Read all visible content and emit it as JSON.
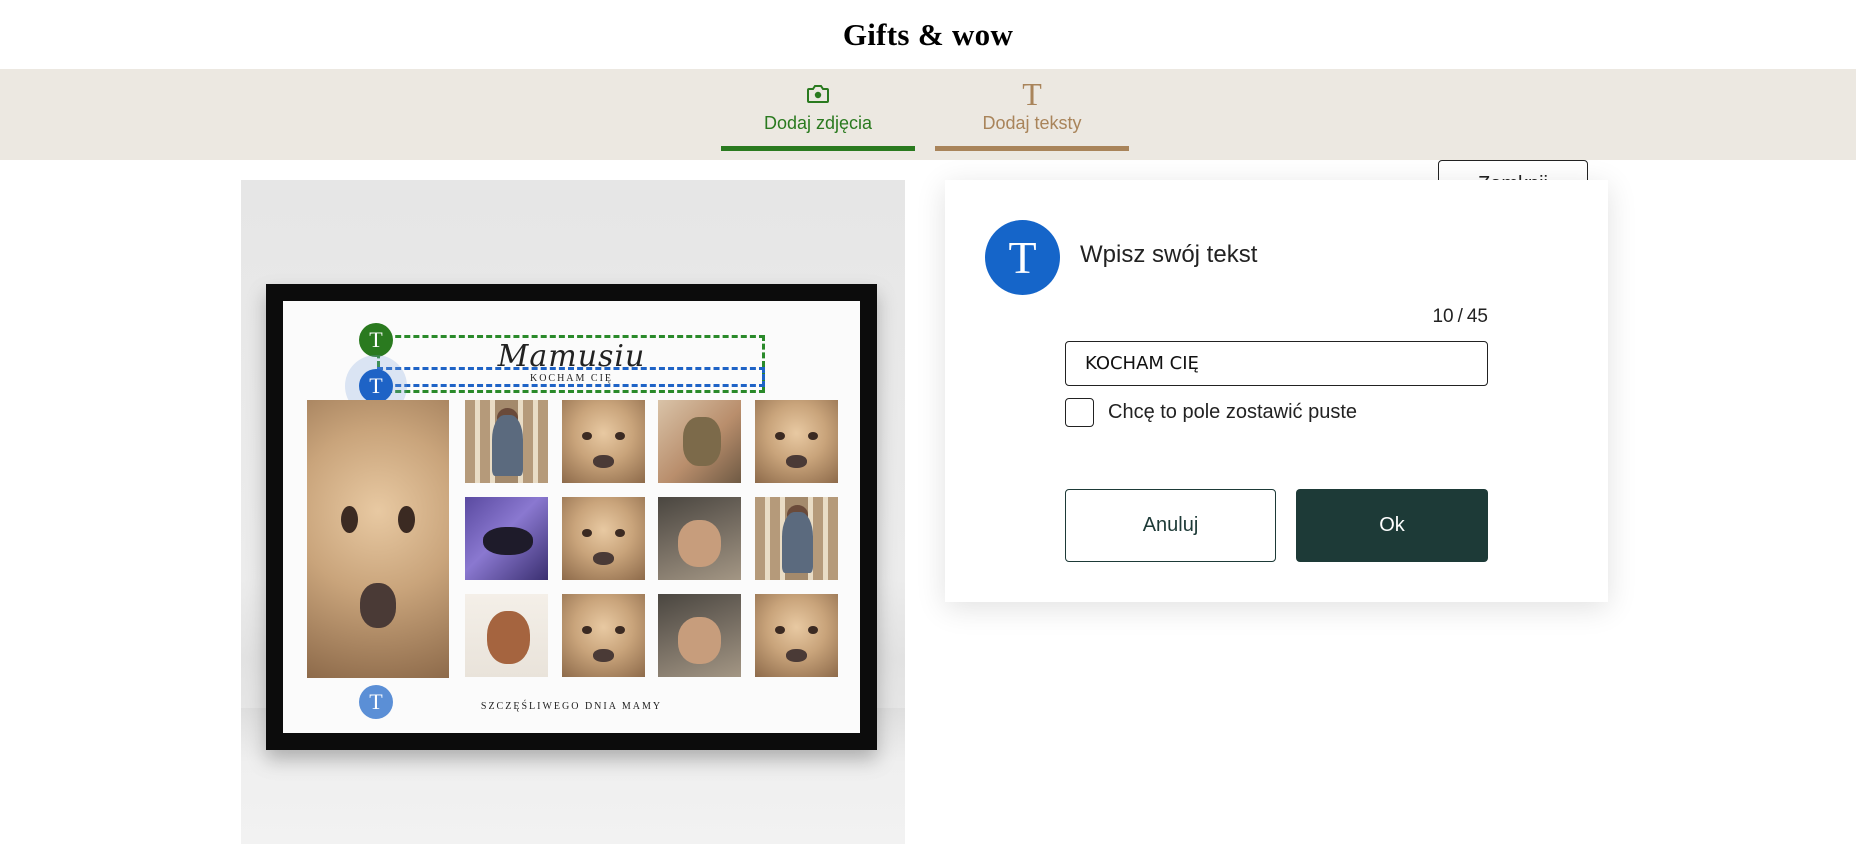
{
  "header": {
    "brand": "Gifts & wow"
  },
  "toolbar": {
    "tabs": [
      {
        "label": "Dodaj zdjęcia",
        "icon": "camera-icon",
        "color": "#2a7a1f"
      },
      {
        "label": "Dodaj teksty",
        "icon": "text-t-icon",
        "icon_glyph": "T",
        "color": "#a9845a"
      }
    ],
    "close_label": "Zamknij"
  },
  "preview": {
    "headline": "Mamusiu",
    "subline": "KOCHAM CIĘ",
    "footer": "SZCZĘŚLIWEGO DNIA MAMY",
    "handle_glyph": "T"
  },
  "editor": {
    "icon_glyph": "T",
    "title": "Wpisz swój tekst",
    "counter": {
      "current": "10",
      "max": "45"
    },
    "input_value": "KOCHAM CIĘ",
    "checkbox_label": "Chcę to pole zostawić puste",
    "checkbox_checked": false,
    "cancel_label": "Anuluj",
    "ok_label": "Ok",
    "accent_color": "#1565c9",
    "primary_color": "#1d3a37"
  }
}
